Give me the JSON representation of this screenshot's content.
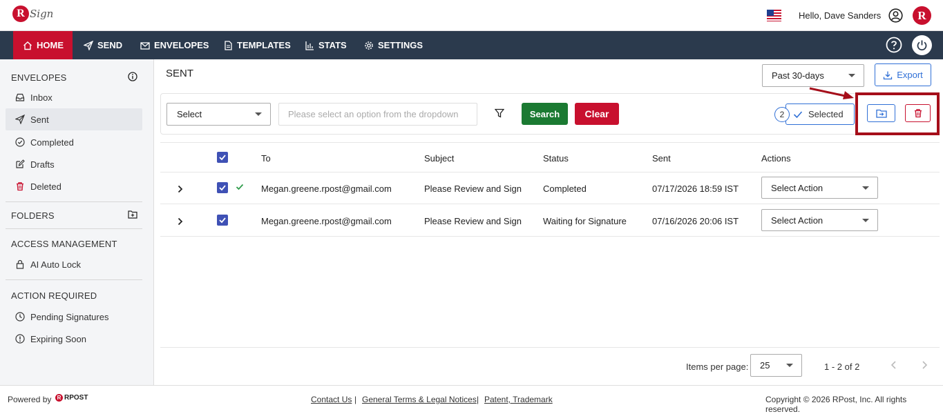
{
  "app": {
    "logo_letter": "R",
    "logo_text": "Sign",
    "greeting": "Hello, Dave Sanders",
    "avatar_letter": "R"
  },
  "nav": [
    {
      "label": "HOME",
      "icon": "home-icon"
    },
    {
      "label": "SEND",
      "icon": "send-icon"
    },
    {
      "label": "ENVELOPES",
      "icon": "envelope-icon"
    },
    {
      "label": "TEMPLATES",
      "icon": "document-icon"
    },
    {
      "label": "STATS",
      "icon": "bar-chart-icon"
    },
    {
      "label": "SETTINGS",
      "icon": "gear-icon"
    }
  ],
  "sidebar": {
    "envelopes_title": "ENVELOPES",
    "items": [
      {
        "label": "Inbox",
        "icon": "inbox-icon"
      },
      {
        "label": "Sent",
        "icon": "send-icon"
      },
      {
        "label": "Completed",
        "icon": "check-circle-icon"
      },
      {
        "label": "Drafts",
        "icon": "edit-icon"
      },
      {
        "label": "Deleted",
        "icon": "trash-icon"
      }
    ],
    "folders_title": "FOLDERS",
    "access_title": "ACCESS MANAGEMENT",
    "access_items": [
      {
        "label": "AI Auto Lock",
        "icon": "lock-icon"
      }
    ],
    "action_title": "ACTION REQUIRED",
    "action_items": [
      {
        "label": "Pending Signatures",
        "icon": "clock-icon"
      },
      {
        "label": "Expiring Soon",
        "icon": "alert-circle-icon"
      }
    ]
  },
  "main": {
    "title": "SENT",
    "range": "Past 30-days",
    "export": "Export",
    "filter_select": "Select",
    "filter_placeholder": "Please select an option from the dropdown",
    "search": "Search",
    "clear": "Clear",
    "selected_count": "2",
    "selected_label": "Selected"
  },
  "table": {
    "headers": [
      "To",
      "Subject",
      "Status",
      "Sent",
      "Actions"
    ],
    "rows": [
      {
        "to": "Megan.greene.rpost@gmail.com",
        "subject": "Please Review and Sign",
        "status": "Completed",
        "sent": "07/17/2026 18:59 IST",
        "action": "Select Action"
      },
      {
        "to": "Megan.greene.rpost@gmail.com",
        "subject": "Please Review and Sign",
        "status": "Waiting for Signature",
        "sent": "07/16/2026 20:06 IST",
        "action": "Select Action"
      }
    ]
  },
  "pager": {
    "label": "Items per page:",
    "size": "25",
    "range": "1 - 2 of 2"
  },
  "footer": {
    "powered": "Powered by",
    "brand": "RPOST",
    "contact": "Contact Us",
    "terms": "General Terms & Legal Notices",
    "patent": "Patent, Trademark",
    "copyright": "Copyright © 2026 RPost, Inc. All rights reserved.",
    "sep": "|"
  },
  "colors": {
    "brand_red": "#c8102e",
    "nav_bg": "#2b3a4d",
    "accent_blue": "#2f6fd6",
    "search_green": "#1b7a32",
    "highlight": "#a50e1a"
  }
}
